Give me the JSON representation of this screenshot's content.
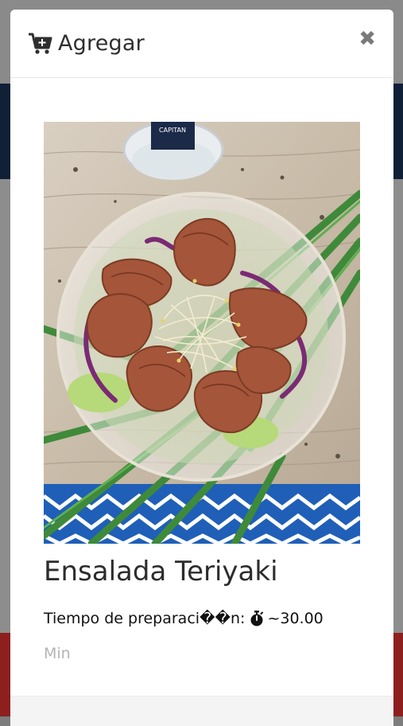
{
  "modal": {
    "title": "Agregar",
    "close_symbol": "✖",
    "icons": {
      "header": "cart-plus-icon",
      "close": "close-icon",
      "timer": "stopwatch-icon"
    }
  },
  "product": {
    "name": "Ensalada Teriyaki",
    "prep_label": "Tiempo de preparaci��n:",
    "prep_value": "~30.00",
    "prep_unit": "Min",
    "image_alt": "salad-photo"
  },
  "colors": {
    "nav": "#0f2037",
    "footer": "#8e1f1f",
    "overlay": "#7d7d7d",
    "title_text": "#2f2f2f",
    "unit_text": "#b4b4b4"
  }
}
